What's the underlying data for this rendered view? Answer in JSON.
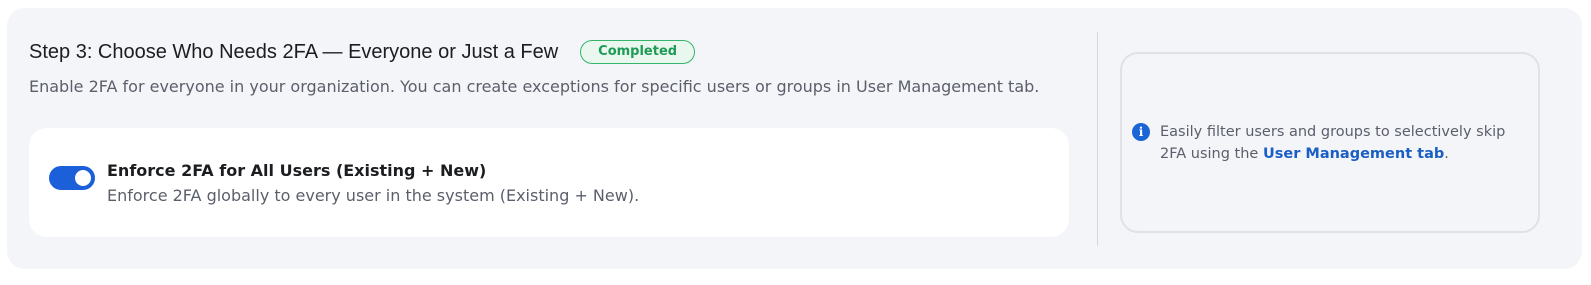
{
  "step": {
    "title": "Step 3: Choose Who Needs 2FA — Everyone or Just a Few",
    "badge": "Completed",
    "subtitle": "Enable 2FA for everyone in your organization. You can create exceptions for specific users or groups in User Management tab."
  },
  "option": {
    "toggle_on": true,
    "title": "Enforce 2FA for All Users (Existing + New)",
    "description": "Enforce 2FA globally to every user in the system (Existing + New)."
  },
  "info": {
    "icon": "info-icon",
    "text_before": "Easily filter users and groups to selectively skip 2FA using the ",
    "link": "User Management tab",
    "text_after": "."
  },
  "colors": {
    "accent": "#1b5fd9",
    "badge_green": "#35b46d",
    "card_bg": "#f4f5f8"
  }
}
